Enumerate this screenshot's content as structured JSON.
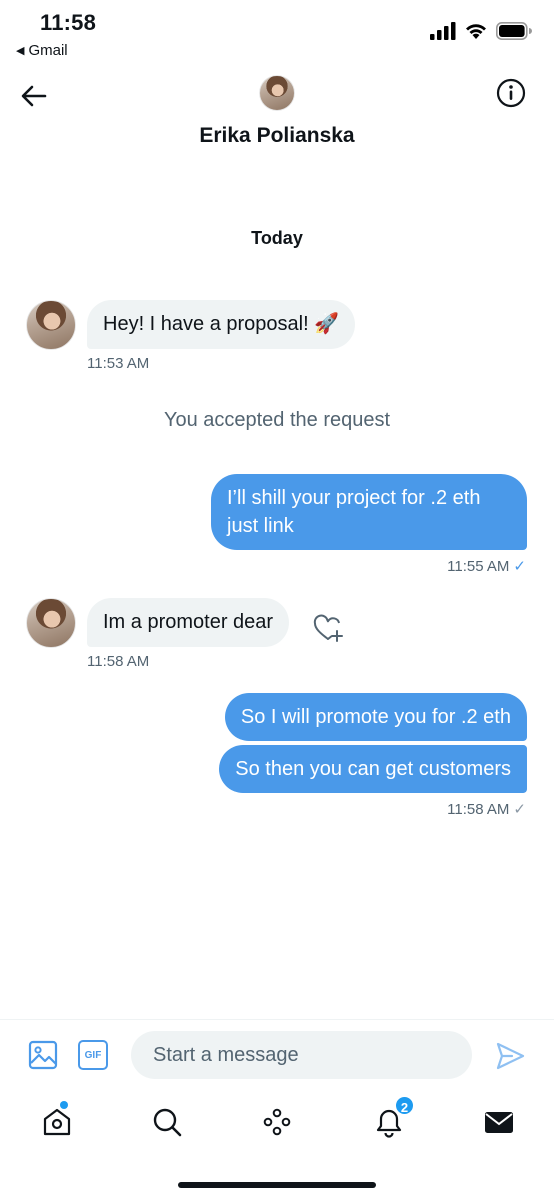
{
  "status_bar": {
    "time": "11:58",
    "back_app": "Gmail",
    "icons": [
      "signal-icon",
      "wifi-icon",
      "battery-icon"
    ]
  },
  "header": {
    "contact_name": "Erika Polianska",
    "icons": [
      "back-arrow-icon",
      "info-icon"
    ]
  },
  "conversation": {
    "day_label": "Today",
    "system_note": "You accepted the request",
    "messages": [
      {
        "direction": "in",
        "text": "Hey! I have a proposal! 🚀",
        "time": "11:53 AM"
      },
      {
        "direction": "out",
        "text": "I’ll shill your project for .2 eth just link",
        "time": "11:55 AM",
        "status": "✓"
      },
      {
        "direction": "in",
        "text": "Im a promoter dear",
        "time": "11:58 AM"
      },
      {
        "direction": "out",
        "text": "So I will promote you for .2 eth"
      },
      {
        "direction": "out",
        "text": "So then you can get customers",
        "time": "11:58 AM",
        "status": "✓"
      }
    ]
  },
  "composer": {
    "placeholder": "Start a message",
    "gif_label": "GIF"
  },
  "tabbar": {
    "notification_count": "2"
  },
  "colors": {
    "accent": "#1d9bf0",
    "outgoing_bubble": "#4a99e9",
    "incoming_bubble": "#eff3f4",
    "secondary_text": "#536471"
  }
}
